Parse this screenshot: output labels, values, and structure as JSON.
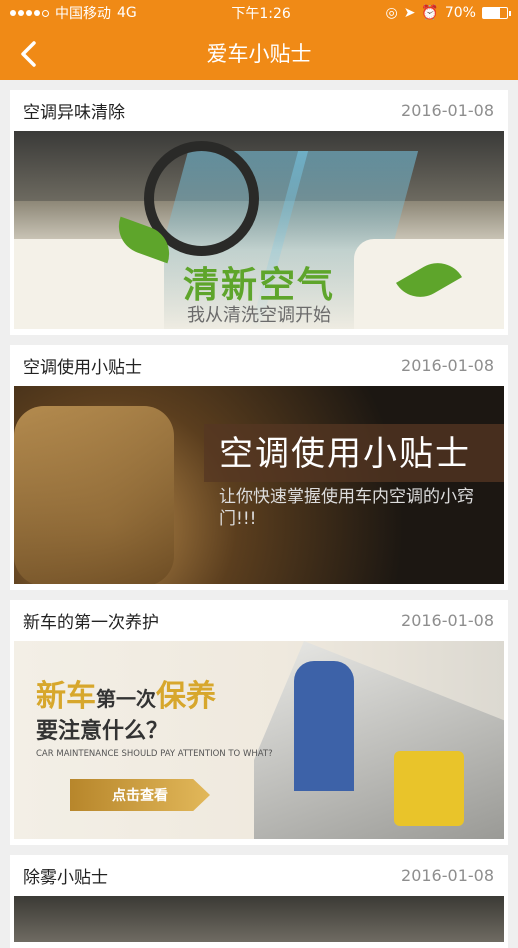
{
  "status_bar": {
    "carrier": "中国移动",
    "network": "4G",
    "time": "下午1:26",
    "battery": "70%",
    "battery_level": 0.7
  },
  "nav": {
    "title": "爱车小贴士",
    "back_icon": "chevron-left-icon"
  },
  "articles": [
    {
      "title": "空调异味清除",
      "date": "2016-01-08",
      "banner": {
        "headline": "清新空气",
        "subline": "我从清洗空调开始"
      }
    },
    {
      "title": "空调使用小贴士",
      "date": "2016-01-08",
      "banner": {
        "headline": "空调使用小贴士",
        "subline": "让你快速掌握使用车内空调的小窍门!!!"
      }
    },
    {
      "title": "新车的第一次养护",
      "date": "2016-01-08",
      "banner": {
        "headline_a": "新车",
        "headline_b": "第一次",
        "headline_c": "保养",
        "headline_2": "要注意什么？",
        "english": "CAR MAINTENANCE SHOULD PAY ATTENTION TO WHAT?",
        "button": "点击查看"
      }
    },
    {
      "title": "除雾小贴士",
      "date": "2016-01-08"
    }
  ],
  "colors": {
    "brand": "#f08a16",
    "date_gray": "#8e8e8e",
    "gold": "#d7a72c"
  }
}
